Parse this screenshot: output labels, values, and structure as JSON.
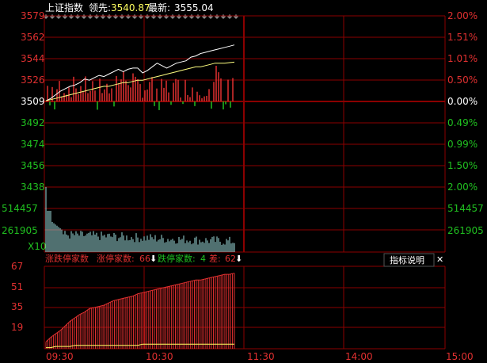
{
  "header": {
    "index_name": "上证指数",
    "leader_label": "领先:",
    "leader_value": "3540.87",
    "latest_label": "最新:",
    "latest_value": "3555.04"
  },
  "price_axis": {
    "left_up": [
      "3579",
      "3562",
      "3544",
      "3526"
    ],
    "base": "3509",
    "left_down": [
      "3492",
      "3474",
      "3456",
      "3438"
    ],
    "right_up": [
      "2.00%",
      "1.51%",
      "1.01%",
      "0.50%"
    ],
    "right_base": "0.00%",
    "right_down": [
      "0.49%",
      "0.99%",
      "1.50%",
      "2.00%"
    ]
  },
  "volume_axis": {
    "left": [
      "514457",
      "261905"
    ],
    "right": [
      "514457",
      "261905"
    ],
    "unit": "X10"
  },
  "indicator": {
    "title": "涨跌停家数",
    "up_label": "涨停家数:",
    "up_value": "66",
    "down_label": "跌停家数:",
    "down_value": "4",
    "diff_label": "差:",
    "diff_value": "62",
    "arrow": "⬇",
    "help_button": "指标说明",
    "close_button": "✕",
    "y_ticks": [
      "67",
      "51",
      "35",
      "19"
    ]
  },
  "time_axis": [
    "09:30",
    "10:30",
    "11:30",
    "14:00",
    "15:00"
  ],
  "colors": {
    "grid": "#8B0000",
    "up_red": "#E03030",
    "down_green": "#20C020",
    "price_line": "#FFFFFF",
    "avg_line": "#FFFF80",
    "volume_bar": "#A0E0E0",
    "header_value": "#FFFF60"
  },
  "chart_data": [
    {
      "type": "line",
      "name": "intraday-price",
      "x_range": [
        "09:30",
        "15:00"
      ],
      "ylim": [
        3438,
        3579
      ],
      "base": 3509,
      "series": [
        {
          "points": [
            3509,
            3511,
            3514,
            3517,
            3519,
            3521,
            3522,
            3524,
            3527,
            3526,
            3528,
            3530,
            3529,
            3531,
            3533,
            3535,
            3533,
            3535,
            3536,
            3536,
            3532,
            3534,
            3537,
            3540,
            3538,
            3536,
            3538,
            3540,
            3541,
            3542,
            3545,
            3546,
            3548,
            3549,
            3550,
            3551,
            3552,
            3553,
            3554,
            3555.04
          ]
        },
        {
          "points": [
            3509,
            3510,
            3511,
            3512,
            3513,
            3514,
            3515,
            3516,
            3517,
            3518,
            3519,
            3520,
            3521,
            3521,
            3522,
            3523,
            3524,
            3524,
            3525,
            3526,
            3526,
            3527,
            3528,
            3529,
            3530,
            3531,
            3532,
            3533,
            3534,
            3535,
            3536,
            3537,
            3537,
            3538,
            3539,
            3540,
            3540,
            3540,
            3540.5,
            3540.87
          ]
        }
      ]
    },
    {
      "type": "bar",
      "name": "up-down-limit-count",
      "ylim": [
        0,
        72
      ],
      "series": [
        {
          "name": "涨停家数",
          "values": [
            6,
            10,
            13,
            16,
            20,
            24,
            27,
            30,
            32,
            35,
            36,
            37,
            38,
            40,
            42,
            43,
            44,
            45,
            46,
            48,
            49,
            50,
            51,
            52,
            53,
            54,
            55,
            56,
            57,
            58,
            59,
            60,
            60,
            61,
            62,
            63,
            64,
            65,
            65,
            66
          ]
        },
        {
          "name": "跌停家数",
          "values": [
            1,
            1,
            2,
            2,
            2,
            2,
            3,
            3,
            3,
            3,
            3,
            3,
            3,
            3,
            3,
            3,
            3,
            3,
            3,
            3,
            4,
            4,
            4,
            4,
            4,
            4,
            4,
            4,
            4,
            4,
            4,
            4,
            4,
            4,
            4,
            4,
            4,
            4,
            4,
            4
          ]
        }
      ]
    }
  ]
}
